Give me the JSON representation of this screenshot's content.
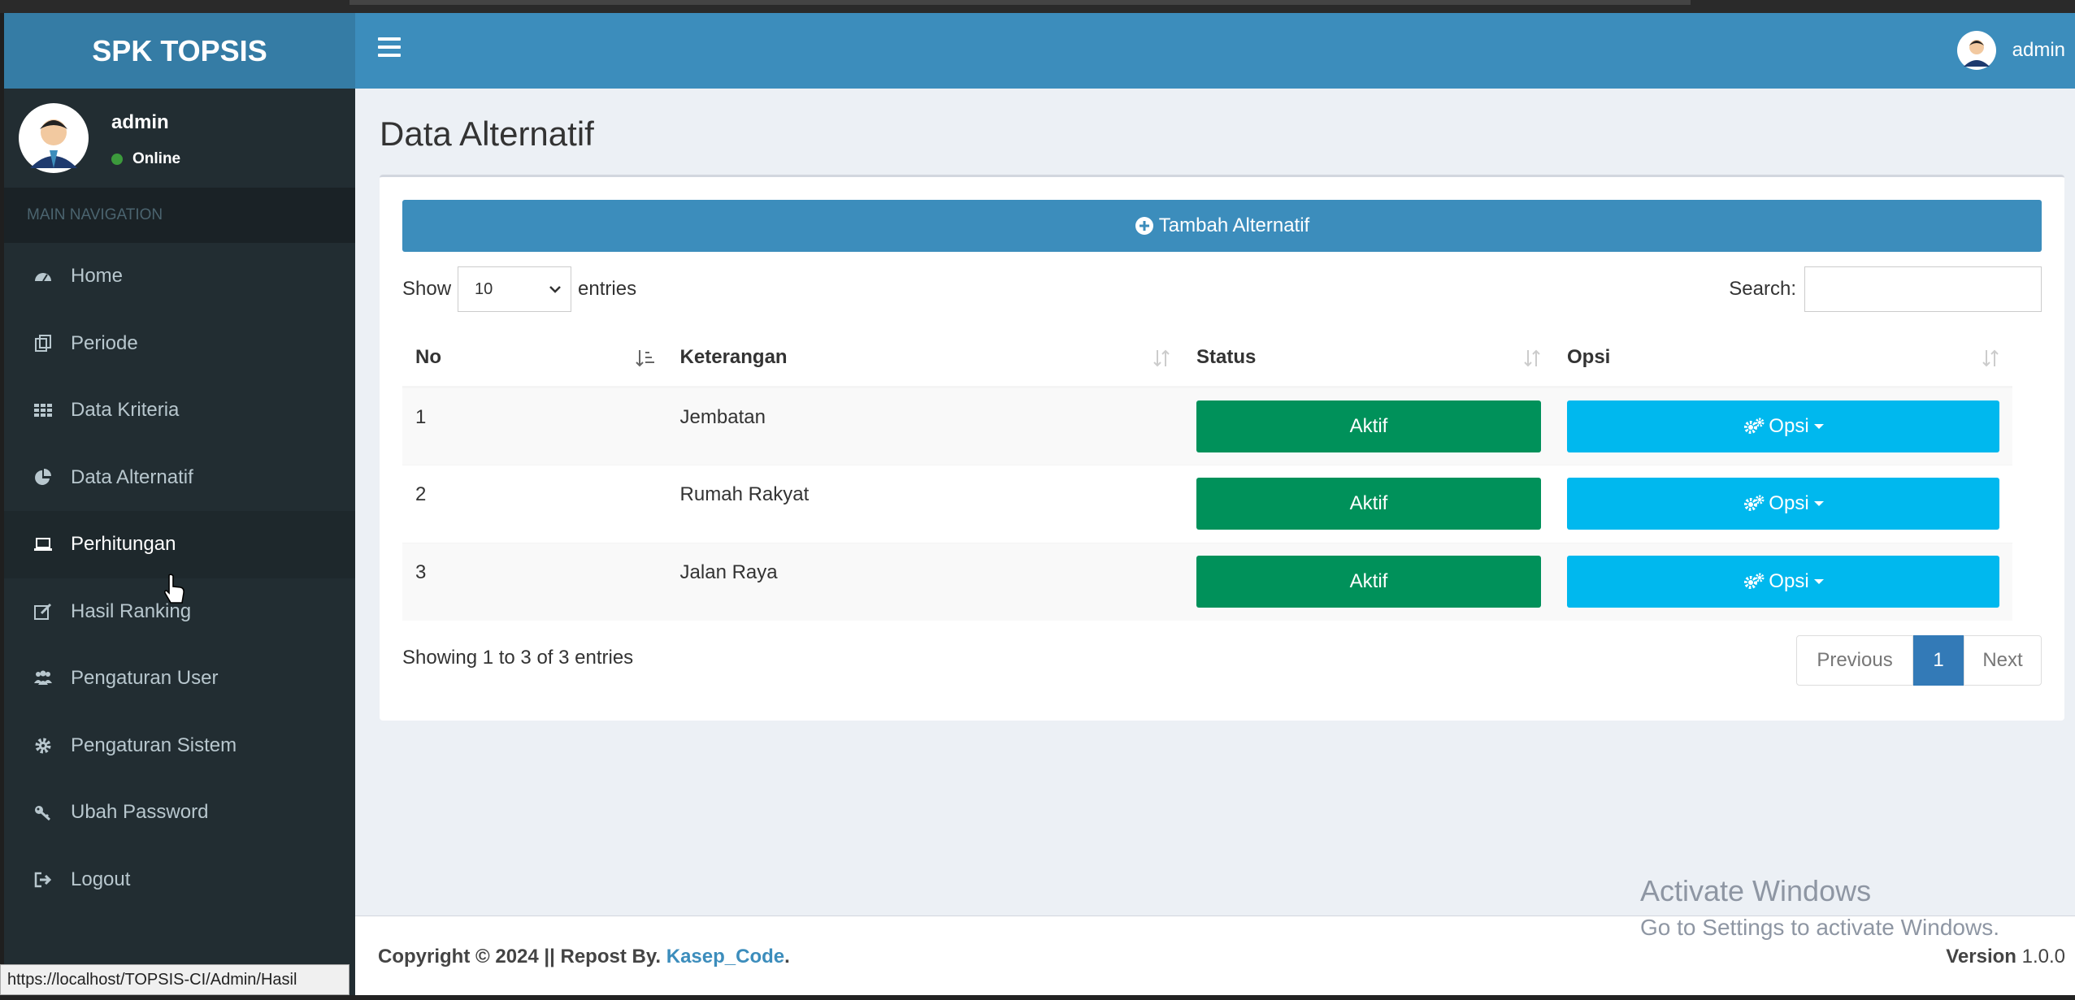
{
  "app": {
    "logo": "SPK TOPSIS"
  },
  "navbar": {
    "user": "admin"
  },
  "sidebar": {
    "user_name": "admin",
    "status": "Online",
    "nav_header": "MAIN NAVIGATION",
    "items": [
      {
        "label": "Home",
        "icon": "dashboard-icon"
      },
      {
        "label": "Periode",
        "icon": "copy-icon"
      },
      {
        "label": "Data Kriteria",
        "icon": "grid-icon"
      },
      {
        "label": "Data Alternatif",
        "icon": "pie-chart-icon"
      },
      {
        "label": "Perhitungan",
        "icon": "laptop-icon"
      },
      {
        "label": "Hasil Ranking",
        "icon": "edit-icon"
      },
      {
        "label": "Pengaturan User",
        "icon": "users-icon"
      },
      {
        "label": "Pengaturan Sistem",
        "icon": "gear-icon"
      },
      {
        "label": "Ubah Password",
        "icon": "key-icon"
      },
      {
        "label": "Logout",
        "icon": "sign-out-icon"
      }
    ]
  },
  "main": {
    "title": "Data Alternatif",
    "add_button": "Tambah Alternatif",
    "show_label": "Show",
    "show_value": "10",
    "entries_label": "entries",
    "search_label": "Search:",
    "columns": [
      "No",
      "Keterangan",
      "Status",
      "Opsi"
    ],
    "rows": [
      {
        "no": "1",
        "keterangan": "Jembatan",
        "status": "Aktif",
        "opsi": "Opsi"
      },
      {
        "no": "2",
        "keterangan": "Rumah Rakyat",
        "status": "Aktif",
        "opsi": "Opsi"
      },
      {
        "no": "3",
        "keterangan": "Jalan Raya",
        "status": "Aktif",
        "opsi": "Opsi"
      }
    ],
    "info": "Showing 1 to 3 of 3 entries",
    "pager": {
      "prev": "Previous",
      "current": "1",
      "next": "Next"
    }
  },
  "footer": {
    "copyright_prefix": "Copyright © 2024 || Repost By.",
    "author": "Kasep_Code",
    "version_label": "Version",
    "version_value": "1.0.0"
  },
  "watermark": {
    "line1": "Activate Windows",
    "line2": "Go to Settings to activate Windows."
  },
  "status_url": "https://localhost/TOPSIS-CI/Admin/Hasil"
}
